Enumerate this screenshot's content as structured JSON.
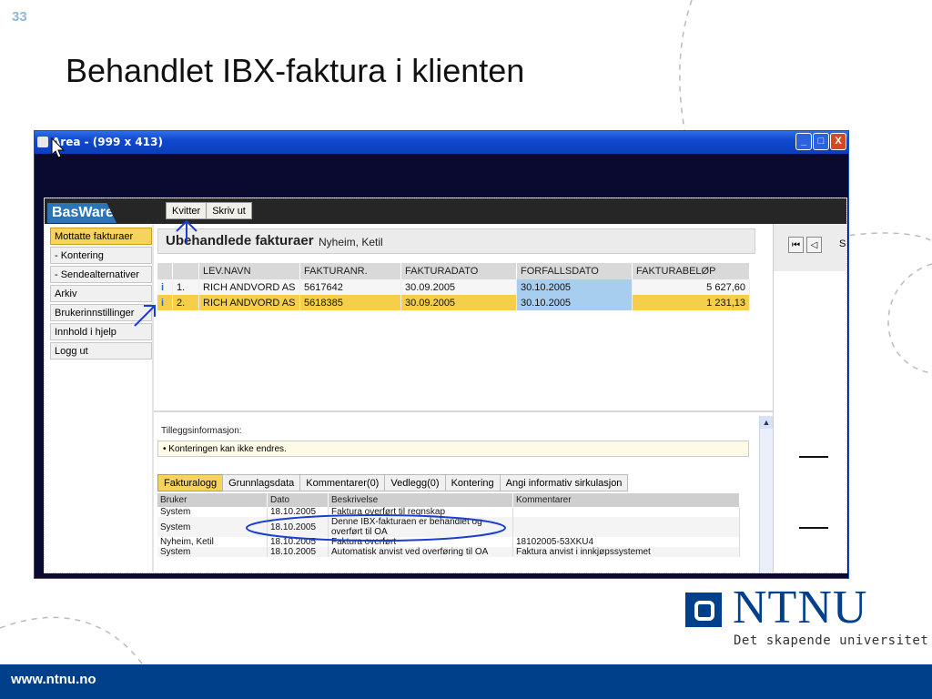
{
  "slide": {
    "number": "33",
    "title": "Behandlet IBX-faktura i klienten",
    "footer_url": "www.ntnu.no",
    "logo_text": "NTNU",
    "logo_subtitle": "Det skapende universitet"
  },
  "window": {
    "title": "Area - (999 x 413)",
    "controls": [
      "_",
      "□",
      "X"
    ]
  },
  "app": {
    "brand": "BasWare",
    "toolbar": [
      "Kvitter",
      "Skriv ut"
    ],
    "nav": [
      {
        "label": "Mottatte fakturaer",
        "active": true
      },
      {
        "label": "- Kontering",
        "active": false
      },
      {
        "label": "- Sendealternativer",
        "active": false
      },
      {
        "label": "Arkiv",
        "active": false
      },
      {
        "label": "Brukerinnstillinger",
        "active": false
      },
      {
        "label": "Innhold i hjelp",
        "active": false
      },
      {
        "label": "Logg ut",
        "active": false
      }
    ],
    "header": {
      "title": "Ubehandlede fakturaer",
      "user": "Nyheim, Ketil"
    },
    "invoice_columns": [
      "LEV.NAVN",
      "FAKTURANR.",
      "FAKTURADATO",
      "FORFALLSDATO",
      "FAKTURABELØP"
    ],
    "invoices": [
      {
        "no": "1.",
        "lev": "RICH ANDVORD AS",
        "nr": "5617642",
        "date": "30.09.2005",
        "due": "30.10.2005",
        "amount": "5 627,60"
      },
      {
        "no": "2.",
        "lev": "RICH ANDVORD AS",
        "nr": "5618385",
        "date": "30.09.2005",
        "due": "30.10.2005",
        "amount": "1 231,13"
      }
    ],
    "right_nav": {
      "first": "⏮",
      "prev": "◁",
      "partial": "S"
    },
    "additional_info": {
      "label": "Tilleggsinformasjon:",
      "text": "Konteringen kan ikke endres."
    },
    "tabs": [
      {
        "label": "Fakturalogg",
        "active": true
      },
      {
        "label": "Grunnlagsdata",
        "active": false
      },
      {
        "label": "Kommentarer(0)",
        "active": false
      },
      {
        "label": "Vedlegg(0)",
        "active": false
      },
      {
        "label": "Kontering",
        "active": false
      },
      {
        "label": "Angi informativ sirkulasjon",
        "active": false
      }
    ],
    "log_columns": [
      "Bruker",
      "Dato",
      "Beskrivelse",
      "Kommentarer"
    ],
    "log_rows": [
      {
        "user": "System",
        "date": "18.10.2005",
        "desc": "Faktura overført til regnskap",
        "comment": ""
      },
      {
        "user": "System",
        "date": "18.10.2005",
        "desc": "Denne IBX-fakturaen er behandlet og overført til OA",
        "comment": ""
      },
      {
        "user": "Nyheim, Ketil",
        "date": "18.10.2005",
        "desc": "Faktura overført",
        "comment": "18102005-53XKU4"
      },
      {
        "user": "System",
        "date": "18.10.2005",
        "desc": "Automatisk anvist ved overføring til OA",
        "comment": "Faktura anvist i innkjøpssystemet"
      }
    ]
  },
  "colors": {
    "ntnu_blue": "#00408a",
    "basware_blue": "#2c74b5",
    "highlight_yellow": "#f5cf4a",
    "due_blue": "#a7cdef",
    "annotation_blue": "#1a3fd0"
  }
}
